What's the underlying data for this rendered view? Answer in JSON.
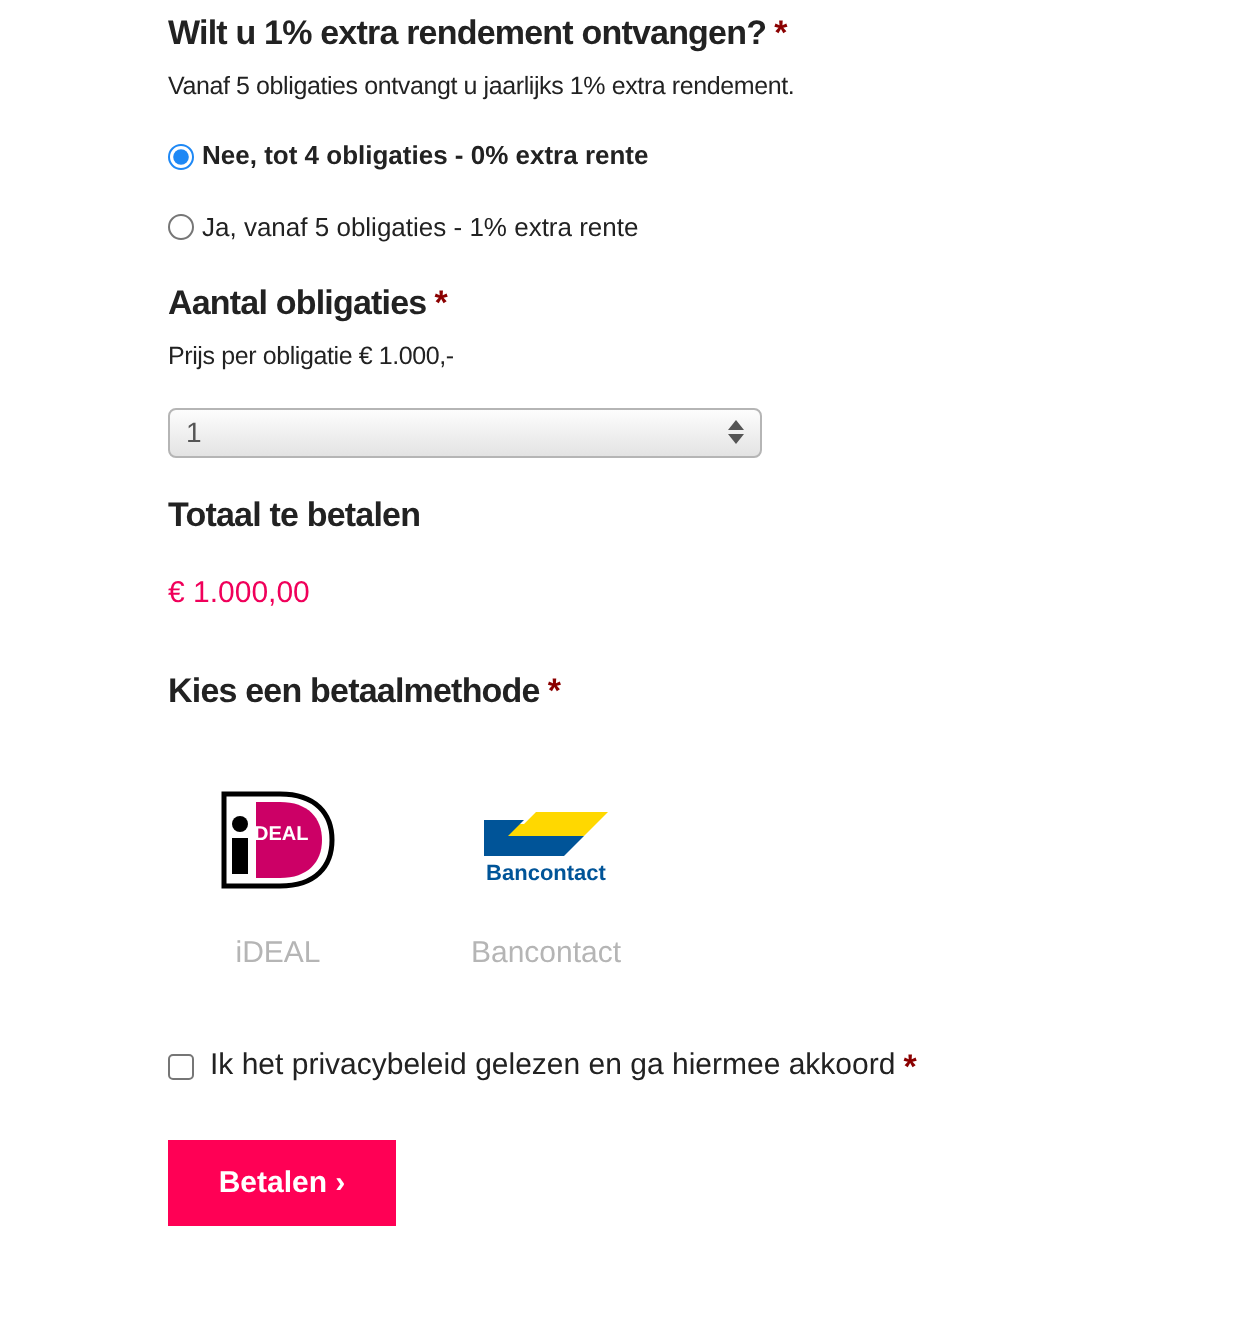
{
  "bonus": {
    "title": "Wilt u 1% extra rendement ontvangen?",
    "required_mark": "*",
    "description": "Vanaf 5 obligaties ontvangt u jaarlijks 1% extra rendement.",
    "options": [
      {
        "label": "Nee, tot 4 obligaties - 0% extra rente",
        "selected": true
      },
      {
        "label": "Ja, vanaf 5 obligaties - 1% extra rente",
        "selected": false
      }
    ]
  },
  "quantity": {
    "title": "Aantal obligaties",
    "required_mark": "*",
    "description": "Prijs per obligatie € 1.000,-",
    "value": "1"
  },
  "total": {
    "title": "Totaal te betalen",
    "amount": "€ 1.000,00"
  },
  "payment": {
    "title": "Kies een betaalmethode",
    "required_mark": "*",
    "methods": [
      {
        "kind": "ideal",
        "logo_text": "DEAL",
        "label": "iDEAL"
      },
      {
        "kind": "bancontact",
        "logo_text": "Bancontact",
        "label": "Bancontact"
      }
    ]
  },
  "privacy": {
    "label": "Ik het privacybeleid gelezen en ga hiermee akkoord",
    "required_mark": "*",
    "checked": false
  },
  "submit": {
    "label": "Betalen ›"
  }
}
